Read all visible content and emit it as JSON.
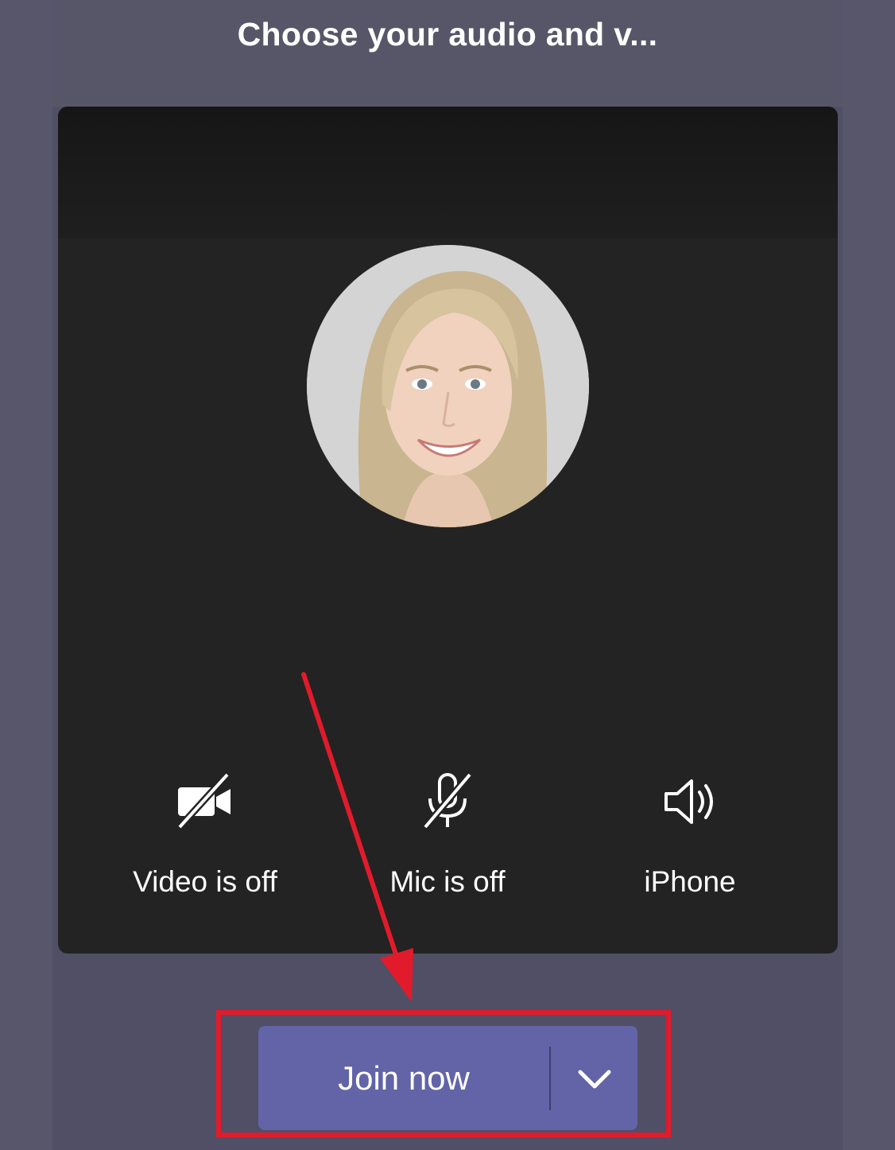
{
  "header": {
    "title": "Choose your audio and v..."
  },
  "controls": {
    "video": {
      "label": "Video is off",
      "icon": "video-off-icon"
    },
    "mic": {
      "label": "Mic is off",
      "icon": "mic-off-icon"
    },
    "speaker": {
      "label": "iPhone",
      "icon": "speaker-icon"
    }
  },
  "join": {
    "label": "Join now",
    "dropdown_icon": "chevron-down-icon"
  },
  "colors": {
    "accent": "#6264a7",
    "background": "#514f65",
    "preview": "#232323",
    "annotation": "#e11b2b"
  }
}
